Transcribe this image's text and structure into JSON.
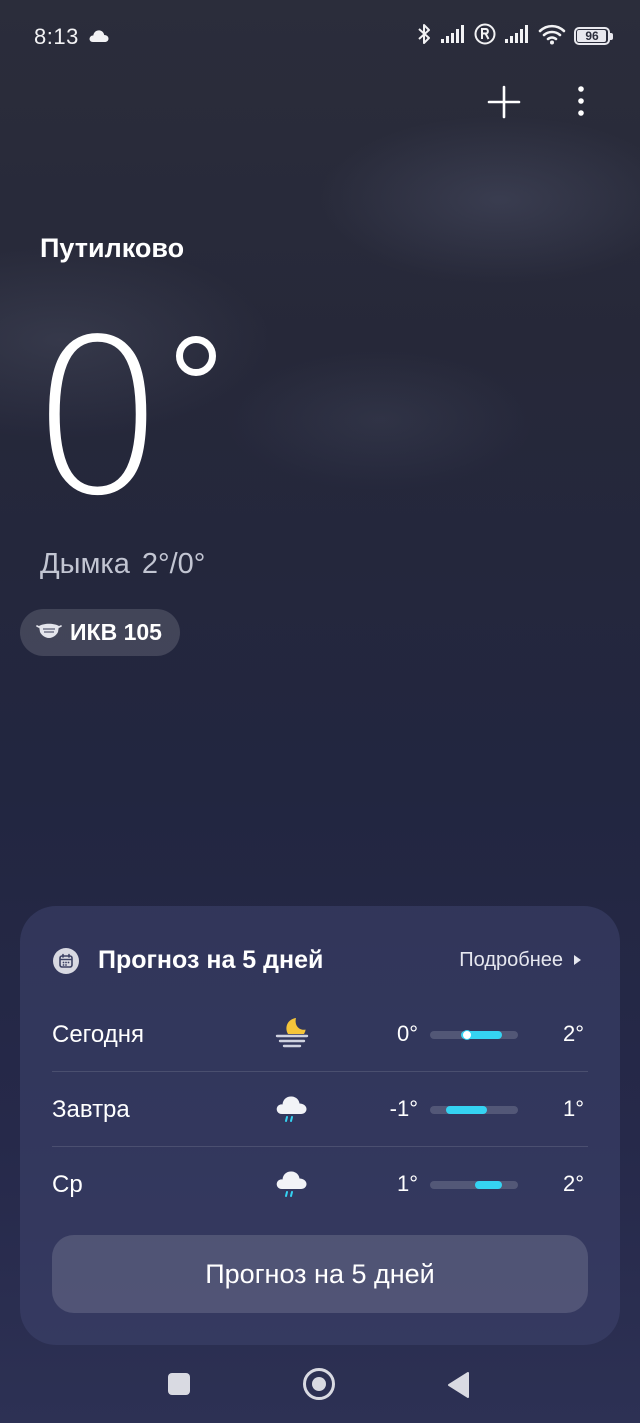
{
  "status_bar": {
    "time": "8:13",
    "battery_level": "96",
    "battery_fraction": 0.96,
    "icons": [
      "cloud-icon",
      "bluetooth-icon",
      "signal-icon",
      "roaming-icon",
      "signal-icon",
      "wifi-icon",
      "battery-icon"
    ]
  },
  "header": {
    "actions": [
      "add-icon",
      "more-vertical-icon"
    ]
  },
  "current": {
    "city": "Путилково",
    "temperature": "0",
    "condition": "Дымка",
    "high_low": "2°/0°",
    "aqi_label": "ИКВ 105",
    "aqi_icon": "mask-icon"
  },
  "forecast": {
    "title": "Прогноз на 5 дней",
    "more_label": "Подробнее",
    "button_label": "Прогноз на 5 дней",
    "accent_color": "#35d3f2",
    "range_min": -1,
    "range_max": 2,
    "days": [
      {
        "day": "Сегодня",
        "icon": "moon-haze-icon",
        "low": "0°",
        "high": "2°",
        "low_value": 0,
        "high_value": 2,
        "current_value": 0
      },
      {
        "day": "Завтра",
        "icon": "rain-cloud-icon",
        "low": "-1°",
        "high": "1°",
        "low_value": -1,
        "high_value": 1
      },
      {
        "day": "Ср",
        "icon": "rain-cloud-icon",
        "low": "1°",
        "high": "2°",
        "low_value": 1,
        "high_value": 2
      }
    ]
  },
  "nav": {
    "buttons": [
      "recent-apps-button",
      "home-button",
      "back-button"
    ]
  }
}
